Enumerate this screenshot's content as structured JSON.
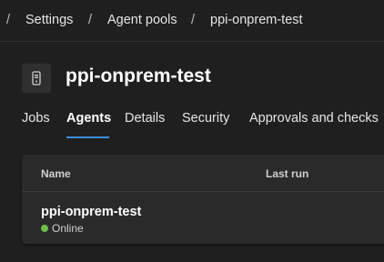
{
  "breadcrumb": {
    "separator": "/",
    "items": [
      "Settings",
      "Agent pools",
      "ppi-onprem-test"
    ]
  },
  "header": {
    "icon": "agent-pool-icon",
    "title": "ppi-onprem-test"
  },
  "tabs": [
    {
      "label": "Jobs",
      "active": false
    },
    {
      "label": "Agents",
      "active": true
    },
    {
      "label": "Details",
      "active": false
    },
    {
      "label": "Security",
      "active": false
    },
    {
      "label": "Approvals and checks",
      "active": false
    }
  ],
  "agents_table": {
    "columns": [
      "Name",
      "Last run"
    ],
    "rows": [
      {
        "name": "ppi-onprem-test",
        "status": "Online",
        "status_color": "#6fbf4b"
      }
    ]
  },
  "colors": {
    "background": "#1f1f1f",
    "card": "#2a2a2a",
    "accent": "#3d8fd6",
    "online": "#6fbf4b"
  }
}
